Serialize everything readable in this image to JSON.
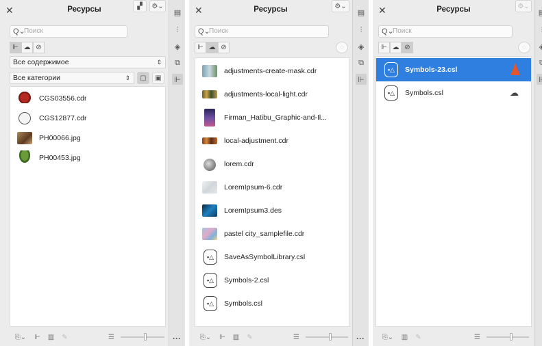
{
  "colors": {
    "selection": "#2f7fe0",
    "warning": "#e4572e"
  },
  "panels": [
    {
      "title": "Ресурсы",
      "search_placeholder": "Поиск",
      "content_filter": "Все содержимое",
      "category_filter": "Все категории",
      "items": [
        {
          "label": "CGS03556.cdr",
          "icon": "pepper-thumbnail"
        },
        {
          "label": "CGS12877.cdr",
          "icon": "monkey-face-thumbnail"
        },
        {
          "label": "PH00066.jpg",
          "icon": "photo-thumbnail"
        },
        {
          "label": "PH00453.jpg",
          "icon": "plant-thumbnail"
        }
      ]
    },
    {
      "title": "Ресурсы",
      "search_placeholder": "Поиск",
      "items": [
        {
          "label": "adjustments-create-mask.cdr",
          "icon": "image-thumbnail"
        },
        {
          "label": "adjustments-local-light.cdr",
          "icon": "image-thumbnail"
        },
        {
          "label": "Firman_Hatibu_Graphic-and-Il...",
          "icon": "image-thumbnail"
        },
        {
          "label": "local-adjustment.cdr",
          "icon": "image-thumbnail"
        },
        {
          "label": "lorem.cdr",
          "icon": "image-thumbnail"
        },
        {
          "label": "LoremIpsum-6.cdr",
          "icon": "image-thumbnail"
        },
        {
          "label": "LoremIpsum3.des",
          "icon": "image-thumbnail"
        },
        {
          "label": "pastel city_samplefile.cdr",
          "icon": "image-thumbnail"
        },
        {
          "label": "SaveAsSymbolLibrary.csl",
          "icon": "symbol-library-icon"
        },
        {
          "label": "Symbols-2.csl",
          "icon": "symbol-library-icon"
        },
        {
          "label": "Symbols.csl",
          "icon": "symbol-library-icon"
        }
      ]
    },
    {
      "title": "Ресурсы",
      "search_placeholder": "Поиск",
      "items": [
        {
          "label": "Symbols-23.csl",
          "icon": "symbol-library-icon",
          "selected": true,
          "status": "warning-icon"
        },
        {
          "label": "Symbols.csl",
          "icon": "symbol-library-icon",
          "status": "cloud-icon"
        }
      ]
    }
  ]
}
